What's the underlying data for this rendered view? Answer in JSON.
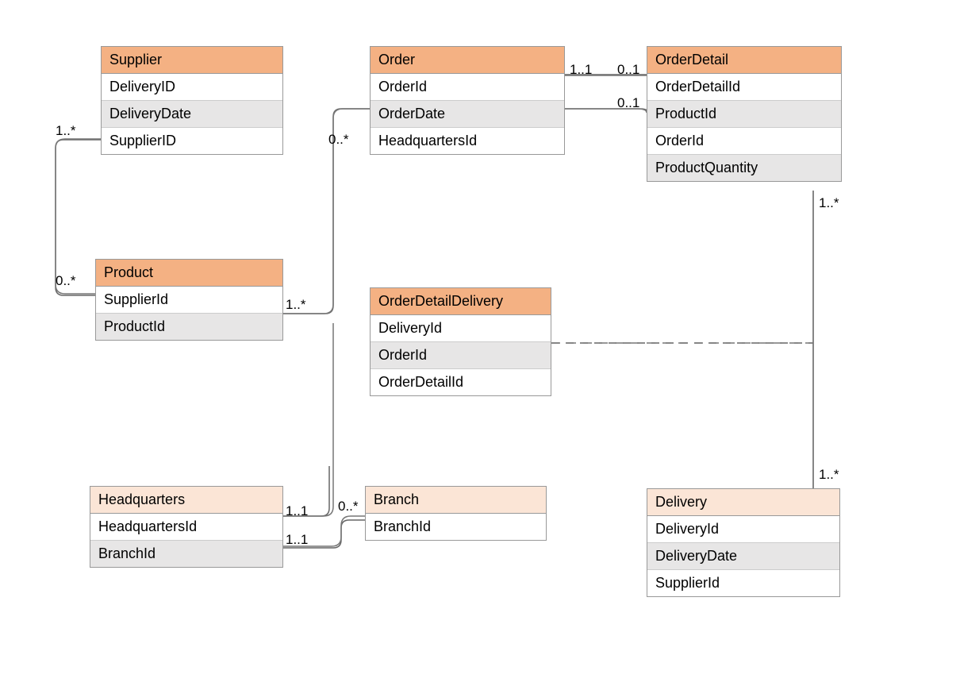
{
  "entities": {
    "supplier": {
      "title": "Supplier",
      "attrs": [
        "DeliveryID",
        "DeliveryDate",
        "SupplierID"
      ]
    },
    "order": {
      "title": "Order",
      "attrs": [
        "OrderId",
        "OrderDate",
        "HeadquartersId"
      ]
    },
    "orderDetail": {
      "title": "OrderDetail",
      "attrs": [
        "OrderDetailId",
        "ProductId",
        "OrderId",
        "ProductQuantity"
      ]
    },
    "product": {
      "title": "Product",
      "attrs": [
        "SupplierId",
        "ProductId"
      ]
    },
    "orderDetailDelivery": {
      "title": "OrderDetailDelivery",
      "attrs": [
        "DeliveryId",
        "OrderId",
        "OrderDetailId"
      ]
    },
    "headquarters": {
      "title": "Headquarters",
      "attrs": [
        "HeadquartersId",
        "BranchId"
      ]
    },
    "branch": {
      "title": "Branch",
      "attrs": [
        "BranchId"
      ]
    },
    "delivery": {
      "title": "Delivery",
      "attrs": [
        "DeliveryId",
        "DeliveryDate",
        "SupplierId"
      ]
    }
  },
  "mult": {
    "supplier_product_top": "1..*",
    "supplier_product_bottom": "0..*",
    "product_orderdetail": "1..*",
    "order_orderdetail_left": "1..1",
    "order_orderdetail_right": "0..1",
    "orderdetail_product_right": "0..1",
    "orderdetail_delivery_top": "1..*",
    "orderdetail_delivery_bottom": "1..*",
    "hq_order": "1..1",
    "hq_branch_left": "1..1",
    "hq_branch_right": "0..*",
    "order_hq_top": "0..*"
  }
}
